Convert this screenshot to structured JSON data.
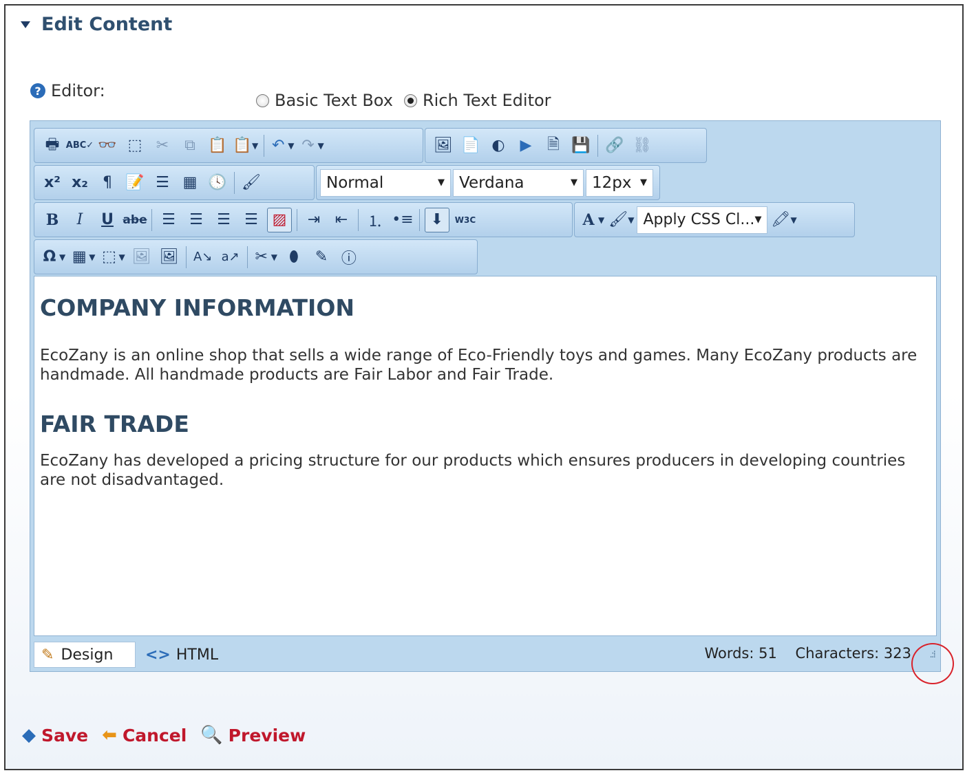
{
  "section": {
    "title": "Edit Content"
  },
  "editor_option": {
    "label": "Editor:",
    "options": [
      {
        "label": "Basic Text Box",
        "selected": false
      },
      {
        "label": "Rich Text Editor",
        "selected": true
      }
    ]
  },
  "toolbar": {
    "row1": [
      "print-icon",
      "spellcheck-icon",
      "find-replace-icon",
      "select-all-icon",
      "cut-icon",
      "copy-icon",
      "paste-icon",
      "paste-options-icon",
      "undo-icon",
      "redo-icon",
      "image-manager-icon",
      "document-manager-icon",
      "flash-manager-icon",
      "media-manager-icon",
      "template-manager-icon",
      "save-template-icon",
      "link-icon",
      "unlink-icon"
    ],
    "paragraph_format": "Normal",
    "font_name": "Verdana",
    "font_size": "12px",
    "css_class": "Apply CSS Cl...",
    "bold": "B",
    "italic": "I",
    "underline": "U",
    "strike": "abe",
    "font_color": "A",
    "omega": "Ω",
    "w3c": "W3C",
    "colors": {
      "accent": "#1f3c65",
      "toolbar_bg": "#bcd8ee",
      "action_red": "#c0182c"
    }
  },
  "content": {
    "heading1": "COMPANY INFORMATION",
    "para1": "EcoZany is an online shop that sells a wide range of Eco-Friendly toys and games. Many EcoZany products are handmade. All handmade products are Fair Labor and Fair Trade.",
    "heading2": "FAIR TRADE",
    "para2": "EcoZany has developed a pricing structure for our products which ensures producers in developing countries are not disadvantaged."
  },
  "footer": {
    "design_tab": "Design",
    "html_tab": "HTML",
    "words": "Words: 51",
    "characters": "Characters: 323"
  },
  "actions": {
    "save": "Save",
    "cancel": "Cancel",
    "preview": "Preview"
  }
}
